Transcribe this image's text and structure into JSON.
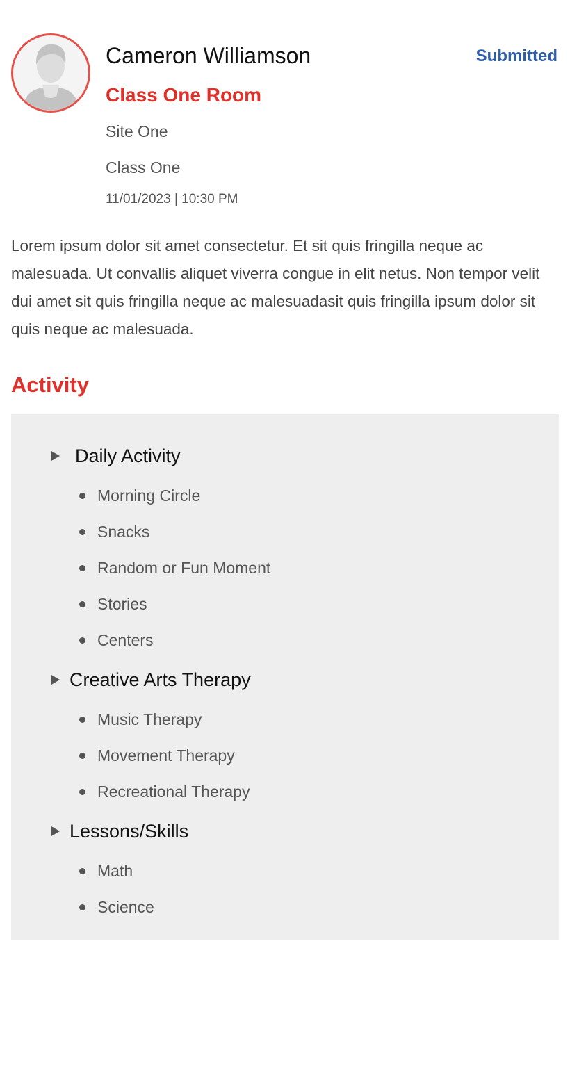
{
  "profile": {
    "name": "Cameron Williamson",
    "status": "Submitted",
    "room": "Class One Room",
    "site": "Site One",
    "class_name": "Class One",
    "datetime": "11/01/2023 | 10:30 PM",
    "avatar_icon": "user-avatar-icon",
    "accent_color": "#e0302a",
    "status_color": "#2f5fa8"
  },
  "description": "Lorem ipsum dolor sit amet consectetur. Et sit quis fringilla neque ac malesuada. Ut convallis aliquet viverra congue in elit netus. Non tempor velit dui amet sit quis fringilla neque ac malesuadasit quis fringilla ipsum dolor sit quis neque ac malesuada.",
  "activity": {
    "heading": "Activity",
    "groups": [
      {
        "title": "Daily Activity",
        "items": [
          "Morning Circle",
          "Snacks",
          "Random or Fun Moment",
          "Stories",
          "Centers"
        ]
      },
      {
        "title": "Creative Arts Therapy",
        "items": [
          "Music Therapy",
          "Movement Therapy",
          "Recreational Therapy"
        ]
      },
      {
        "title": "Lessons/Skills",
        "items": [
          "Math",
          "Science"
        ]
      }
    ]
  }
}
